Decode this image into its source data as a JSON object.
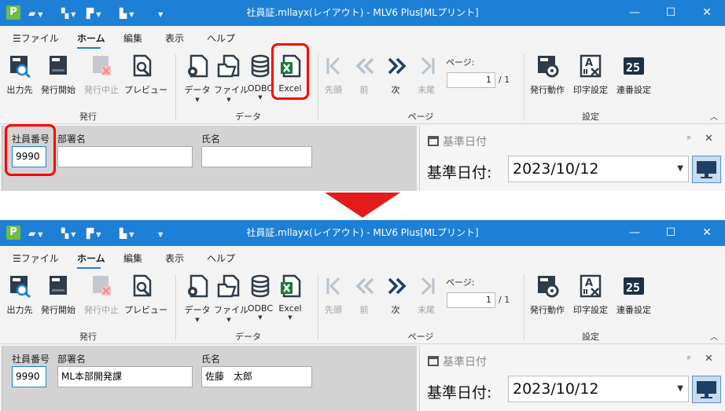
{
  "app": {
    "logo_letter": "P",
    "title": "社員証.mllayx(レイアウト) - MLV6 Plus[MLプリント]"
  },
  "window_buttons": {
    "minimize": "—",
    "maximize": "☐",
    "close": "✕"
  },
  "menu": {
    "items": [
      "ファイル",
      "ホーム",
      "編集",
      "表示",
      "ヘルプ"
    ],
    "active": "ホーム"
  },
  "ribbon": {
    "groups": {
      "issue": {
        "label": "発行",
        "buttons": [
          "出力先",
          "発行開始",
          "発行中止",
          "プレビュー"
        ]
      },
      "data": {
        "label": "データ",
        "buttons": [
          "データ",
          "ファイル",
          "ODBC",
          "Excel"
        ]
      },
      "page": {
        "label": "ページ",
        "buttons": [
          "先頭",
          "前",
          "次",
          "末尾"
        ],
        "page_label": "ページ:",
        "current_page": "1",
        "total": "/ 1"
      },
      "settings": {
        "label": "設定",
        "buttons": [
          "発行動作",
          "印字設定",
          "連番設定"
        ]
      }
    }
  },
  "form_fields": {
    "employee_no": "社員番号",
    "department": "部署名",
    "name": "氏名"
  },
  "screens": [
    {
      "employee_no": "9990",
      "department": "",
      "name": ""
    },
    {
      "employee_no": "9990",
      "department": "ML本部開発課",
      "name": "佐藤　太郎"
    }
  ],
  "date_pane": {
    "title": "基準日付",
    "label": "基準日付:",
    "value": "2023/10/12",
    "pin": "ᵖ",
    "close": "✕"
  },
  "colors": {
    "title_bar": "#1e7fd6",
    "highlight": "#ff0000",
    "arrow": "#e31b1b",
    "excel_green": "#1d7a3a",
    "icon_dark": "#2f3b48"
  }
}
